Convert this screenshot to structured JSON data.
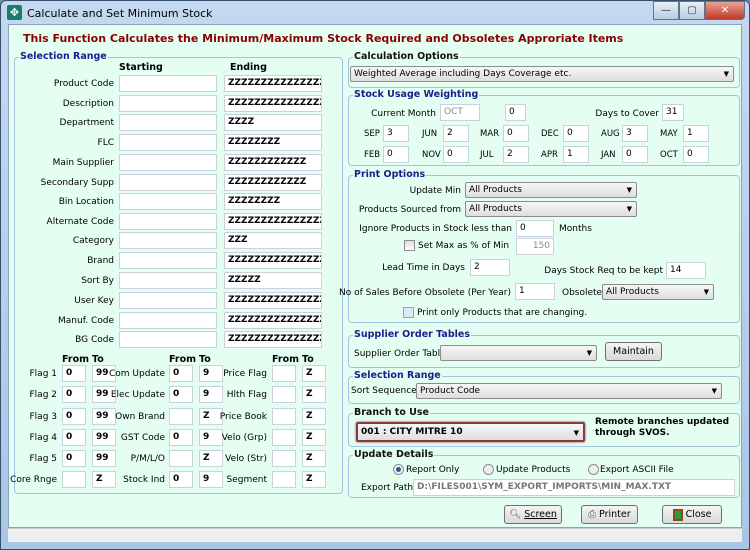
{
  "window": {
    "title": "Calculate and Set Minimum Stock",
    "minimize": "—",
    "maximize": "▢",
    "close": "✕"
  },
  "heading": "This Function Calculates the Minimum/Maximum Stock Required and Obsoletes Approriate Items",
  "selection_range": {
    "title": "Selection Range",
    "starting": "Starting",
    "ending": "Ending",
    "rows": [
      {
        "label": "Product Code",
        "start": "",
        "end": "ZZZZZZZZZZZZZZZ"
      },
      {
        "label": "Description",
        "start": "",
        "end": "ZZZZZZZZZZZZZZZZZZ"
      },
      {
        "label": "Department",
        "start": "",
        "end": "ZZZZ"
      },
      {
        "label": "FLC",
        "start": "",
        "end": "ZZZZZZZZ"
      },
      {
        "label": "Main Supplier",
        "start": "",
        "end": "ZZZZZZZZZZZZ"
      },
      {
        "label": "Secondary Supp",
        "start": "",
        "end": "ZZZZZZZZZZZZ"
      },
      {
        "label": "Bin Location",
        "start": "",
        "end": "ZZZZZZZZ"
      },
      {
        "label": "Alternate Code",
        "start": "",
        "end": "ZZZZZZZZZZZZZZZ"
      },
      {
        "label": "Category",
        "start": "",
        "end": "ZZZ"
      },
      {
        "label": "Brand",
        "start": "",
        "end": "ZZZZZZZZZZZZZZZZ"
      },
      {
        "label": "Sort By",
        "start": "",
        "end": "ZZZZZ"
      },
      {
        "label": "User Key",
        "start": "",
        "end": "ZZZZZZZZZZZZZZZZZZ"
      },
      {
        "label": "Manuf. Code",
        "start": "",
        "end": "ZZZZZZZZZZZZZZZZZZ"
      },
      {
        "label": "BG Code",
        "start": "",
        "end": "ZZZZZZZZZZZZZZZZZZ"
      }
    ],
    "from": "From",
    "to": "To",
    "flags": [
      [
        {
          "label": "Flag 1",
          "from": "0",
          "to": "99"
        },
        {
          "label": "Com Update",
          "from": "0",
          "to": "9"
        },
        {
          "label": "Price Flag",
          "from": "",
          "to": "Z"
        }
      ],
      [
        {
          "label": "Flag 2",
          "from": "0",
          "to": "99"
        },
        {
          "label": "Elec Update",
          "from": "0",
          "to": "9"
        },
        {
          "label": "Hlth Flag",
          "from": "",
          "to": "Z"
        }
      ],
      [
        {
          "label": "Flag 3",
          "from": "0",
          "to": "99"
        },
        {
          "label": "Own Brand",
          "from": "",
          "to": "Z"
        },
        {
          "label": "Price Book",
          "from": "",
          "to": "Z"
        }
      ],
      [
        {
          "label": "Flag 4",
          "from": "0",
          "to": "99"
        },
        {
          "label": "GST Code",
          "from": "0",
          "to": "9"
        },
        {
          "label": "Velo (Grp)",
          "from": "",
          "to": "Z"
        }
      ],
      [
        {
          "label": "Flag 5",
          "from": "0",
          "to": "99"
        },
        {
          "label": "P/M/L/O",
          "from": "",
          "to": "Z"
        },
        {
          "label": "Velo (Str)",
          "from": "",
          "to": "Z"
        }
      ],
      [
        {
          "label": "Core Rnge",
          "from": "",
          "to": "Z"
        },
        {
          "label": "Stock Ind",
          "from": "0",
          "to": "9"
        },
        {
          "label": "Segment",
          "from": "",
          "to": "Z"
        }
      ]
    ]
  },
  "calc_options": {
    "title": "Calculation Options",
    "selected": "Weighted Average including Days Coverage etc."
  },
  "stock_usage": {
    "title": "Stock Usage Weighting",
    "current_month_label": "Current Month",
    "current_month": "OCT",
    "current_value": "0",
    "days_to_cover_label": "Days to Cover",
    "days_to_cover": "31",
    "months": [
      [
        {
          "m": "SEP",
          "v": "3"
        },
        {
          "m": "JUN",
          "v": "2"
        },
        {
          "m": "MAR",
          "v": "0"
        },
        {
          "m": "DEC",
          "v": "0"
        },
        {
          "m": "AUG",
          "v": "3"
        },
        {
          "m": "MAY",
          "v": "1"
        }
      ],
      [
        {
          "m": "FEB",
          "v": "0"
        },
        {
          "m": "NOV",
          "v": "0"
        },
        {
          "m": "JUL",
          "v": "2"
        },
        {
          "m": "APR",
          "v": "1"
        },
        {
          "m": "JAN",
          "v": "0"
        },
        {
          "m": "OCT",
          "v": "0"
        }
      ]
    ]
  },
  "print_options": {
    "title": "Print Options",
    "update_min_label": "Update Min",
    "update_min": "All Products",
    "sourced_label": "Products Sourced from",
    "sourced": "All Products",
    "ignore_label": "Ignore Products in Stock less than",
    "ignore_value": "0",
    "months_label": "Months",
    "set_max_label": "Set Max as % of Min",
    "set_max_checked": false,
    "set_max_value": "150",
    "lead_time_label": "Lead Time in Days",
    "lead_time": "2",
    "days_stock_label": "Days Stock Req to be kept",
    "days_stock": "14",
    "sales_label": "No of Sales Before Obsolete (Per Year)",
    "sales": "1",
    "obsolete_label": "Obsolete",
    "obsolete": "All Products",
    "print_changing_label": "Print only Products that are changing.",
    "print_changing_checked": false
  },
  "supplier_tables": {
    "title": "Supplier Order Tables",
    "label": "Supplier Order Table",
    "selected": "",
    "maintain": "Maintain"
  },
  "sort_range": {
    "title": "Selection Range",
    "label": "Sort Sequence",
    "selected": "Product Code"
  },
  "branch": {
    "title": "Branch to Use",
    "selected": "001 : CITY MITRE 10",
    "note1": "Remote branches updated",
    "note2": "through  SVOS.",
    "highlight": "#8b3a3a"
  },
  "update_details": {
    "title": "Update Details",
    "options": [
      "Report Only",
      "Update Products",
      "Export ASCII File"
    ],
    "selected": "Report Only",
    "export_label": "Export Path",
    "export_path": "D:\\FILES001\\SYM_EXPORT_IMPORTS\\MIN_MAX.TXT"
  },
  "buttons": {
    "screen": "Screen",
    "printer": "Printer",
    "close": "Close"
  },
  "colors": {
    "background": "#e4fef2",
    "heading": "#8b0000",
    "group_title": "#1c1c8c"
  }
}
